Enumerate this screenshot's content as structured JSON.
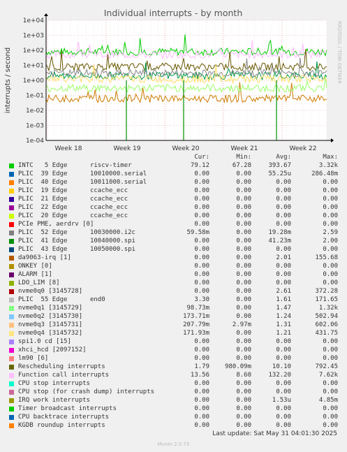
{
  "chart_data": {
    "type": "line",
    "title": "Individual interrupts - by month",
    "ylabel": "interrupts / second",
    "side_label": "RRDTOOL / TOBI OETIKER",
    "y_scale": "log",
    "ylim": [
      0.0001,
      10000
    ],
    "y_ticks": [
      "1e-04",
      "1e-03",
      "1e-02",
      "1e-01",
      "1e+00",
      "1e+01",
      "1e+02",
      "1e+03",
      "1e+04"
    ],
    "x_ticks": [
      "Week 18",
      "Week 19",
      "Week 20",
      "Week 21",
      "Week 22"
    ],
    "grid": true,
    "series_levels": [
      {
        "name": "INTC 5 Edge riscv-timer",
        "color": "#00cc00",
        "level": 80
      },
      {
        "name": "Function call interrupts",
        "color": "#ffbbff",
        "level": 50
      },
      {
        "name": "Rescheduling interrupts",
        "color": "#665a00",
        "level": 8
      },
      {
        "name": "PLIC 41 Edge 10040000.spi",
        "color": "#00994c",
        "level": 2
      },
      {
        "name": "PLIC 52 Edge 10030000.i2c",
        "color": "#cc7a00",
        "level": 0.06
      },
      {
        "name": "PLIC 55 Edge end0",
        "color": "#888888",
        "level": 3
      },
      {
        "name": "nvme0q1",
        "color": "#99ff66",
        "level": 0.3
      },
      {
        "name": "nvme0q4",
        "color": "#ffe066",
        "level": 1.2
      }
    ]
  },
  "legend": {
    "headers": {
      "cur": "Cur:",
      "min": "Min:",
      "avg": "Avg:",
      "max": "Max:"
    },
    "rows": [
      {
        "name": "INTC   5 Edge      riscv-timer",
        "color": "#00cc00",
        "cur": "79.12",
        "min": "67.28",
        "avg": "393.67",
        "max": "3.32k"
      },
      {
        "name": "PLIC  39 Edge      10010000.serial",
        "color": "#0066b3",
        "cur": "0.00",
        "min": "0.00",
        "avg": "55.25u",
        "max": "286.48m"
      },
      {
        "name": "PLIC  40 Edge      10011000.serial",
        "color": "#ff8000",
        "cur": "0.00",
        "min": "0.00",
        "avg": "0.00",
        "max": "0.00"
      },
      {
        "name": "PLIC  19 Edge      ccache_ecc",
        "color": "#ffcc00",
        "cur": "0.00",
        "min": "0.00",
        "avg": "0.00",
        "max": "0.00"
      },
      {
        "name": "PLIC  21 Edge      ccache_ecc",
        "color": "#330099",
        "cur": "0.00",
        "min": "0.00",
        "avg": "0.00",
        "max": "0.00"
      },
      {
        "name": "PLIC  22 Edge      ccache_ecc",
        "color": "#990099",
        "cur": "0.00",
        "min": "0.00",
        "avg": "0.00",
        "max": "0.00"
      },
      {
        "name": "PLIC  20 Edge      ccache_ecc",
        "color": "#ccff00",
        "cur": "0.00",
        "min": "0.00",
        "avg": "0.00",
        "max": "0.00"
      },
      {
        "name": "PCIe PME, aerdrv [0]",
        "color": "#ff0000",
        "cur": "0.00",
        "min": "0.00",
        "avg": "0.00",
        "max": "0.00"
      },
      {
        "name": "PLIC  52 Edge      10030000.i2c",
        "color": "#808080",
        "cur": "59.58m",
        "min": "0.00",
        "avg": "19.28m",
        "max": "2.59"
      },
      {
        "name": "PLIC  41 Edge      10040000.spi",
        "color": "#008f00",
        "cur": "0.00",
        "min": "0.00",
        "avg": "41.23m",
        "max": "2.00"
      },
      {
        "name": "PLIC  43 Edge      10050000.spi",
        "color": "#00487d",
        "cur": "0.00",
        "min": "0.00",
        "avg": "0.00",
        "max": "0.00"
      },
      {
        "name": "da9063-irq [1]",
        "color": "#b35a00",
        "cur": "0.00",
        "min": "0.00",
        "avg": "2.01",
        "max": "155.68"
      },
      {
        "name": "ONKEY [0]",
        "color": "#b38f00",
        "cur": "0.00",
        "min": "0.00",
        "avg": "0.00",
        "max": "0.00"
      },
      {
        "name": "ALARM [1]",
        "color": "#6b006b",
        "cur": "0.00",
        "min": "0.00",
        "avg": "0.00",
        "max": "0.00"
      },
      {
        "name": "LDO_LIM [8]",
        "color": "#8fb300",
        "cur": "0.00",
        "min": "0.00",
        "avg": "0.00",
        "max": "0.00"
      },
      {
        "name": "nvme0q0 [3145728]",
        "color": "#b30000",
        "cur": "0.00",
        "min": "0.00",
        "avg": "2.61",
        "max": "372.28"
      },
      {
        "name": "PLIC  55 Edge      end0",
        "color": "#bebebe",
        "cur": "3.30",
        "min": "0.00",
        "avg": "1.61",
        "max": "171.65"
      },
      {
        "name": "nvme0q1 [3145729]",
        "color": "#80ff80",
        "cur": "98.73m",
        "min": "0.00",
        "avg": "1.47",
        "max": "1.32k"
      },
      {
        "name": "nvme0q2 [3145730]",
        "color": "#80c9ff",
        "cur": "173.71m",
        "min": "0.00",
        "avg": "1.24",
        "max": "502.94"
      },
      {
        "name": "nvme0q3 [3145731]",
        "color": "#ffc080",
        "cur": "207.79m",
        "min": "2.97m",
        "avg": "1.31",
        "max": "602.06"
      },
      {
        "name": "nvme0q4 [3145732]",
        "color": "#ffe680",
        "cur": "171.93m",
        "min": "0.00",
        "avg": "1.21",
        "max": "431.75"
      },
      {
        "name": "spi1.0 cd [15]",
        "color": "#aa80ff",
        "cur": "0.00",
        "min": "0.00",
        "avg": "0.00",
        "max": "0.00"
      },
      {
        "name": "xhci_hcd [2097152]",
        "color": "#ee00cc",
        "cur": "0.00",
        "min": "0.00",
        "avg": "0.00",
        "max": "0.00"
      },
      {
        "name": "lm90 [6]",
        "color": "#ff8080",
        "cur": "0.00",
        "min": "0.00",
        "avg": "0.00",
        "max": "0.00"
      },
      {
        "name": "Rescheduling interrupts",
        "color": "#666600",
        "cur": "1.79",
        "min": "980.09m",
        "avg": "10.10",
        "max": "792.45"
      },
      {
        "name": "Function call interrupts",
        "color": "#ffbfff",
        "cur": "13.56",
        "min": "8.60",
        "avg": "132.20",
        "max": "7.62k"
      },
      {
        "name": "CPU stop interrupts",
        "color": "#00ffcc",
        "cur": "0.00",
        "min": "0.00",
        "avg": "0.00",
        "max": "0.00"
      },
      {
        "name": "CPU stop (for crash dump) interrupts",
        "color": "#cc6699",
        "cur": "0.00",
        "min": "0.00",
        "avg": "0.00",
        "max": "0.00"
      },
      {
        "name": "IRQ work interrupts",
        "color": "#999900",
        "cur": "0.00",
        "min": "0.00",
        "avg": "1.53u",
        "max": "4.85m"
      },
      {
        "name": "Timer broadcast interrupts",
        "color": "#00cc00",
        "cur": "0.00",
        "min": "0.00",
        "avg": "0.00",
        "max": "0.00"
      },
      {
        "name": "CPU backtrace interrupts",
        "color": "#0066b3",
        "cur": "0.00",
        "min": "0.00",
        "avg": "0.00",
        "max": "0.00"
      },
      {
        "name": "KGDB roundup interrupts",
        "color": "#ff8000",
        "cur": "0.00",
        "min": "0.00",
        "avg": "0.00",
        "max": "0.00"
      }
    ]
  },
  "footer": {
    "last_update": "Last update: Sat May 31 04:01:30 2025",
    "munin": "Munin 2.0.73"
  }
}
